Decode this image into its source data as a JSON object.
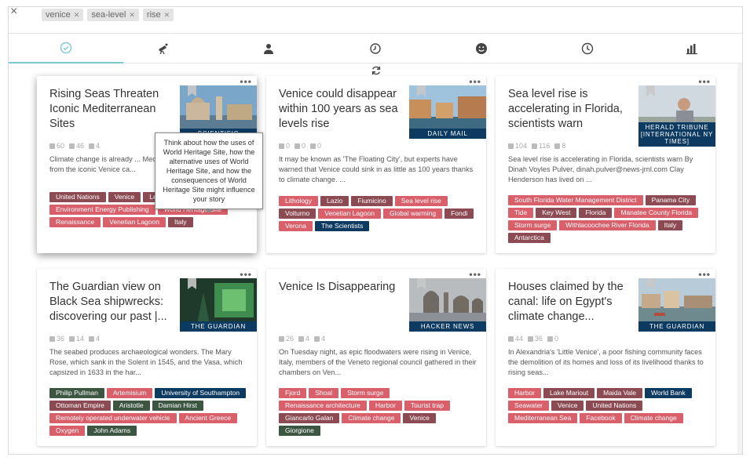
{
  "search": {
    "close": "×",
    "chips": [
      {
        "label": "venice"
      },
      {
        "label": "sea-level"
      },
      {
        "label": "rise"
      }
    ]
  },
  "tabs": [
    {
      "icon": "check-circle-icon"
    },
    {
      "icon": "telescope-icon"
    },
    {
      "icon": "person-icon"
    },
    {
      "icon": "history-icon"
    },
    {
      "icon": "smiley-icon"
    },
    {
      "icon": "clock-icon"
    },
    {
      "icon": "bar-chart-icon"
    }
  ],
  "colors": {
    "red": "#d95f6b",
    "brown": "#8c4a52",
    "navy": "#0d3a61",
    "green": "#3c5641",
    "accent": "#7ec8d4"
  },
  "cards": [
    {
      "title": "Rising Seas Threaten Iconic Mediterranean Sites",
      "source": "SCIENTIFIC",
      "stats": [
        "60",
        "46",
        "4"
      ],
      "desc": "Climate change is already ... Mediterranean's most trea... from the iconic Venice ca...",
      "tags": [
        {
          "t": "United Nations",
          "c": "brown"
        },
        {
          "t": "Venice",
          "c": "brown"
        },
        {
          "t": "Lebanon",
          "c": "brown"
        },
        {
          "t": "Germany",
          "c": "brown"
        },
        {
          "t": "Environment Energy Publishing",
          "c": "red"
        },
        {
          "t": "World Heritage Site",
          "c": "red"
        },
        {
          "t": "Renaissance",
          "c": "red"
        },
        {
          "t": "Venetian Lagoon",
          "c": "red"
        },
        {
          "t": "Italy",
          "c": "brown"
        }
      ]
    },
    {
      "title": "Venice could disappear within 100 years as sea levels rise",
      "source": "DAILY MAIL",
      "stats": [
        "0",
        "0",
        "0"
      ],
      "desc": "It may be known as 'The Floating City', but experts have warned that Venice could sink in as little as 100 years thanks to climate change. ...",
      "tags": [
        {
          "t": "Lithology",
          "c": "red"
        },
        {
          "t": "Lazio",
          "c": "brown"
        },
        {
          "t": "Fiumicino",
          "c": "brown"
        },
        {
          "t": "Sea level rise",
          "c": "red"
        },
        {
          "t": "Volturno",
          "c": "brown"
        },
        {
          "t": "Venetian Lagoon",
          "c": "red"
        },
        {
          "t": "Global warming",
          "c": "red"
        },
        {
          "t": "Fondi",
          "c": "brown"
        },
        {
          "t": "Verona",
          "c": "red"
        },
        {
          "t": "The Scientists",
          "c": "navy"
        }
      ]
    },
    {
      "title": "Sea level rise is accelerating in Florida, scientists warn",
      "source": "HERALD TRIBUNE [INTERNATIONAL NY TIMES]",
      "stats": [
        "104",
        "116",
        "8"
      ],
      "desc": "Sea level rise is accelerating in Florida, scientists warn By Dinah Voyles Pulver, dinah.pulver@news-jrnl.com Clay Henderson has lived on ...",
      "tags": [
        {
          "t": "South Florida Water Management District",
          "c": "red"
        },
        {
          "t": "Panama City",
          "c": "brown"
        },
        {
          "t": "Tide",
          "c": "red"
        },
        {
          "t": "Key West",
          "c": "brown"
        },
        {
          "t": "Florida",
          "c": "brown"
        },
        {
          "t": "Manatee County Florida",
          "c": "red"
        },
        {
          "t": "Storm surge",
          "c": "red"
        },
        {
          "t": "Withlacoochee River Florida",
          "c": "red"
        },
        {
          "t": "Italy",
          "c": "brown"
        },
        {
          "t": "Antarctica",
          "c": "brown"
        }
      ]
    },
    {
      "title": "The Guardian view on Black Sea shipwrecks: discovering our past |...",
      "source": "THE GUARDIAN",
      "stats": [
        "36",
        "14",
        "4"
      ],
      "desc": "The seabed produces archaeological wonders. The Mary Rose, which sank in the Solent in 1545, and the Vasa, which capsized in 1633 in the har...",
      "tags": [
        {
          "t": "Philip Pullman",
          "c": "green"
        },
        {
          "t": "Artemisium",
          "c": "red"
        },
        {
          "t": "University of Southampton",
          "c": "navy"
        },
        {
          "t": "Ottoman Empire",
          "c": "brown"
        },
        {
          "t": "Aristotle",
          "c": "green"
        },
        {
          "t": "Damian Hirst",
          "c": "green"
        },
        {
          "t": "Remotely operated underwater vehicle",
          "c": "red"
        },
        {
          "t": "Ancient Greece",
          "c": "red"
        },
        {
          "t": "Oxygen",
          "c": "red"
        },
        {
          "t": "John Adams",
          "c": "green"
        }
      ]
    },
    {
      "title": "Venice Is Disappearing",
      "source": "HACKER NEWS",
      "stats": [
        "26",
        "4",
        "4"
      ],
      "desc": "On Tuesday night, as epic floodwaters were rising in Venice, Italy, members of the Veneto regional council gathered in their chambers on Ven...",
      "tags": [
        {
          "t": "Fjord",
          "c": "red"
        },
        {
          "t": "Shoal",
          "c": "red"
        },
        {
          "t": "Storm surge",
          "c": "red"
        },
        {
          "t": "Renaissance architecture",
          "c": "red"
        },
        {
          "t": "Harbor",
          "c": "red"
        },
        {
          "t": "Tourist trap",
          "c": "red"
        },
        {
          "t": "Giancarlo Galan",
          "c": "brown"
        },
        {
          "t": "Climate change",
          "c": "red"
        },
        {
          "t": "Venice",
          "c": "brown"
        },
        {
          "t": "Giorgione",
          "c": "green"
        }
      ]
    },
    {
      "title": "Houses claimed by the canal: life on Egypt's climate change...",
      "source": "THE GUARDIAN",
      "stats": [
        "44",
        "36",
        "0"
      ],
      "desc": "In Alexandria's 'Little Venice', a poor fishing community faces the demolition of its homes and loss of its livelihood thanks to rising seas...",
      "tags": [
        {
          "t": "Harbor",
          "c": "red"
        },
        {
          "t": "Lake Mariout",
          "c": "brown"
        },
        {
          "t": "Maida Vale",
          "c": "brown"
        },
        {
          "t": "World Bank",
          "c": "navy"
        },
        {
          "t": "Seawater",
          "c": "red"
        },
        {
          "t": "Venice",
          "c": "brown"
        },
        {
          "t": "United Nations",
          "c": "brown"
        },
        {
          "t": "Mediterranean Sea",
          "c": "red"
        },
        {
          "t": "Facebook",
          "c": "red"
        },
        {
          "t": "Climate change",
          "c": "red"
        }
      ]
    }
  ],
  "tooltip": {
    "text": "Think about how the uses of World Heritage Site, how the alternative uses of World Heritage Site, and how the consequences of World Heritage Site might influence your story"
  }
}
